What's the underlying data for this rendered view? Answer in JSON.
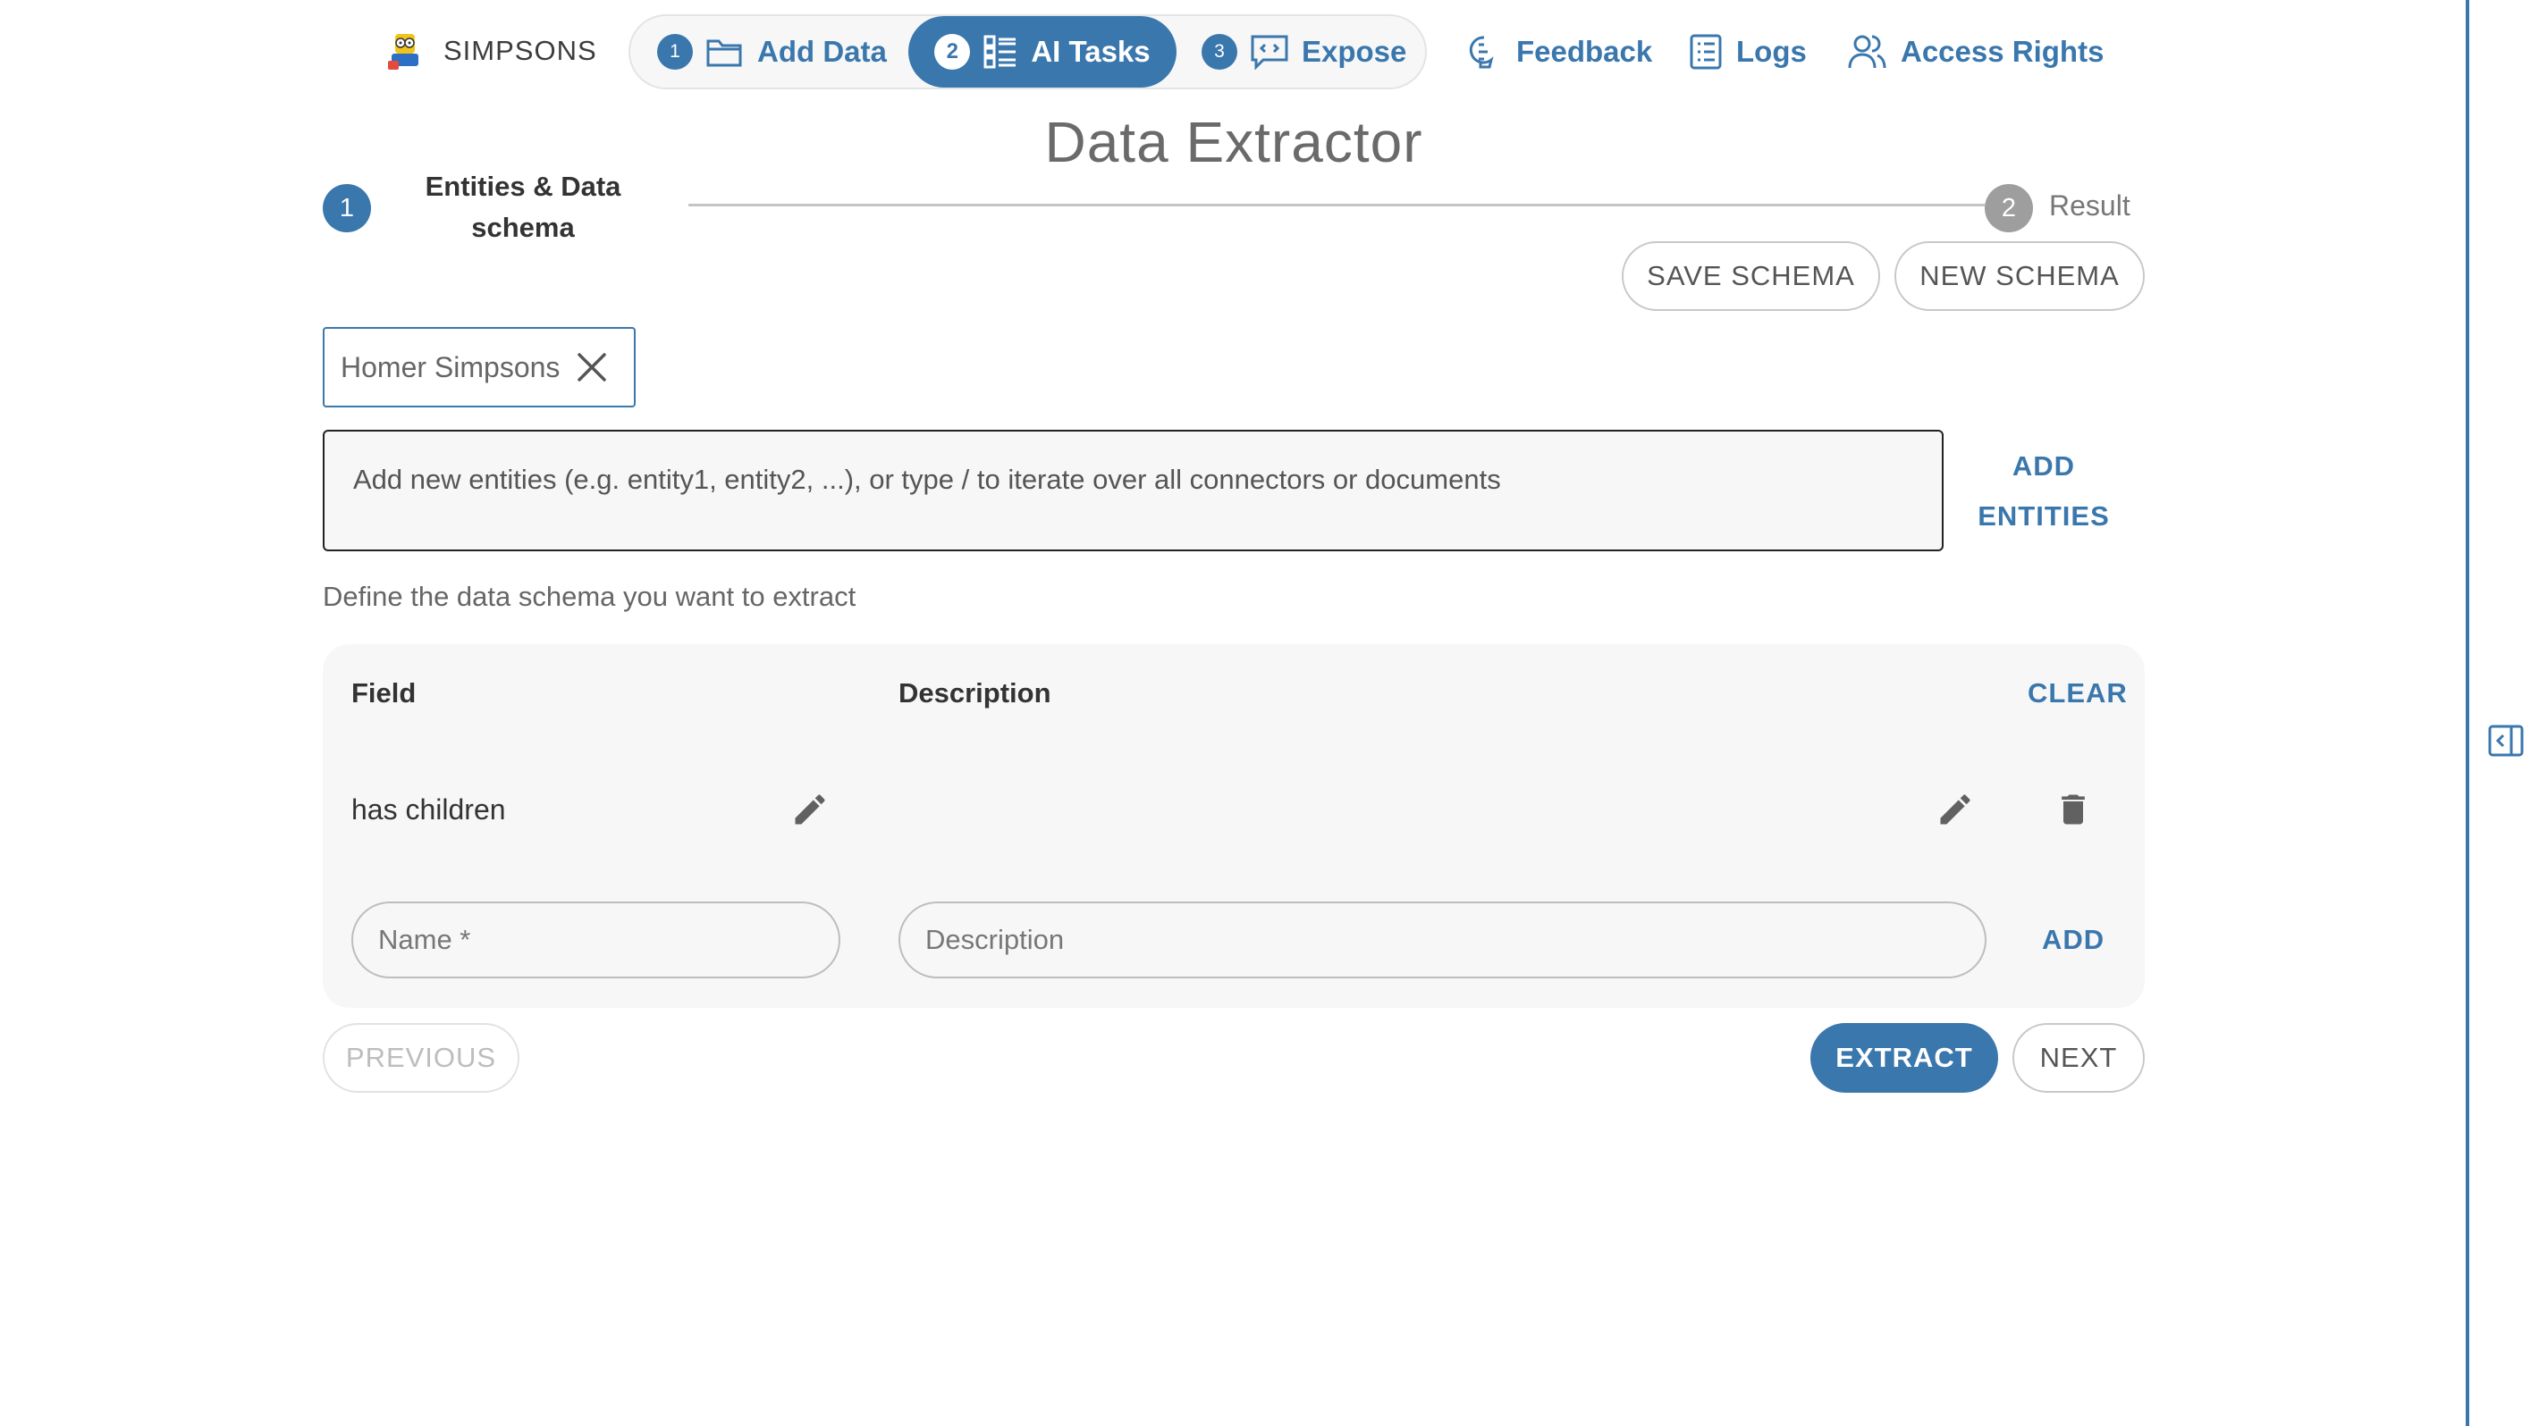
{
  "brand": {
    "name": "SIMPSONS"
  },
  "steps": [
    {
      "num": "1",
      "label": "Add Data"
    },
    {
      "num": "2",
      "label": "AI Tasks"
    },
    {
      "num": "3",
      "label": "Expose"
    }
  ],
  "nav": {
    "feedback": "Feedback",
    "logs": "Logs",
    "access_rights": "Access Rights"
  },
  "page": {
    "title": "Data Extractor"
  },
  "stepper": {
    "step1_num": "1",
    "step1_label": "Entities & Data schema",
    "step2_num": "2",
    "step2_label": "Result"
  },
  "schema_actions": {
    "save": "SAVE SCHEMA",
    "new": "NEW SCHEMA"
  },
  "entities": {
    "chips": [
      "Homer Simpsons"
    ],
    "placeholder": "Add new entities (e.g. entity1, entity2, ...), or type / to iterate over all connectors or documents",
    "add_line1": "ADD",
    "add_line2": "ENTITIES"
  },
  "schema": {
    "hint": "Define the data schema you want to extract",
    "headers": {
      "field": "Field",
      "description": "Description"
    },
    "clear": "CLEAR",
    "rows": [
      {
        "field": "has children",
        "description": ""
      }
    ],
    "name_placeholder": "Name *",
    "description_placeholder": "Description",
    "add": "ADD"
  },
  "footer": {
    "previous": "PREVIOUS",
    "extract": "EXTRACT",
    "next": "NEXT"
  },
  "colors": {
    "accent": "#3a77ad",
    "card_bg": "#f7f7f7",
    "border": "#c8c8c8"
  }
}
